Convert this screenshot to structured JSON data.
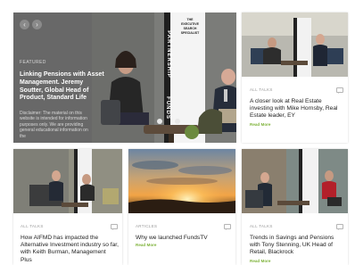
{
  "featured": {
    "label": "FEATURED",
    "title": "Linking Pensions with Asset Management. Jeremy Soutter, Global Head of Product, Standard Life",
    "disclaimer": "Disclaimer: The material on this website is intended for information purposes only. We are providing general educational information on the",
    "banner_brand": "PARTNERSHIP",
    "banner_funds": "FUNDS",
    "banner_tagline": [
      "THE",
      "EXECUTIVE",
      "SEARCH",
      "SPECIALIST"
    ]
  },
  "cards": [
    {
      "tag": "ALL TALKS",
      "title": "A closer look at Real Estate investing with Mike Hornsby, Real Estate leader, EY",
      "more": "Read More"
    },
    {
      "tag": "ALL TALKS",
      "title": "How AIFMD has impacted the Alternative Investment industry so far, with Keith Burman, Management Plus",
      "more": ""
    },
    {
      "tag": "ARTICLES",
      "title": "Why we launched FundsTV",
      "more": "Read More"
    },
    {
      "tag": "ALL TALKS",
      "title": "Trends in Savings and Pensions with Tony Stenning, UK Head of Retail, Blackrock",
      "more": "Read More"
    }
  ],
  "colors": {
    "accent_green": "#7fb33b",
    "featured_bg": "#6b6b6b"
  },
  "icons": {
    "prev": "chevron-left-icon",
    "next": "chevron-right-icon",
    "comment": "comment-icon"
  }
}
